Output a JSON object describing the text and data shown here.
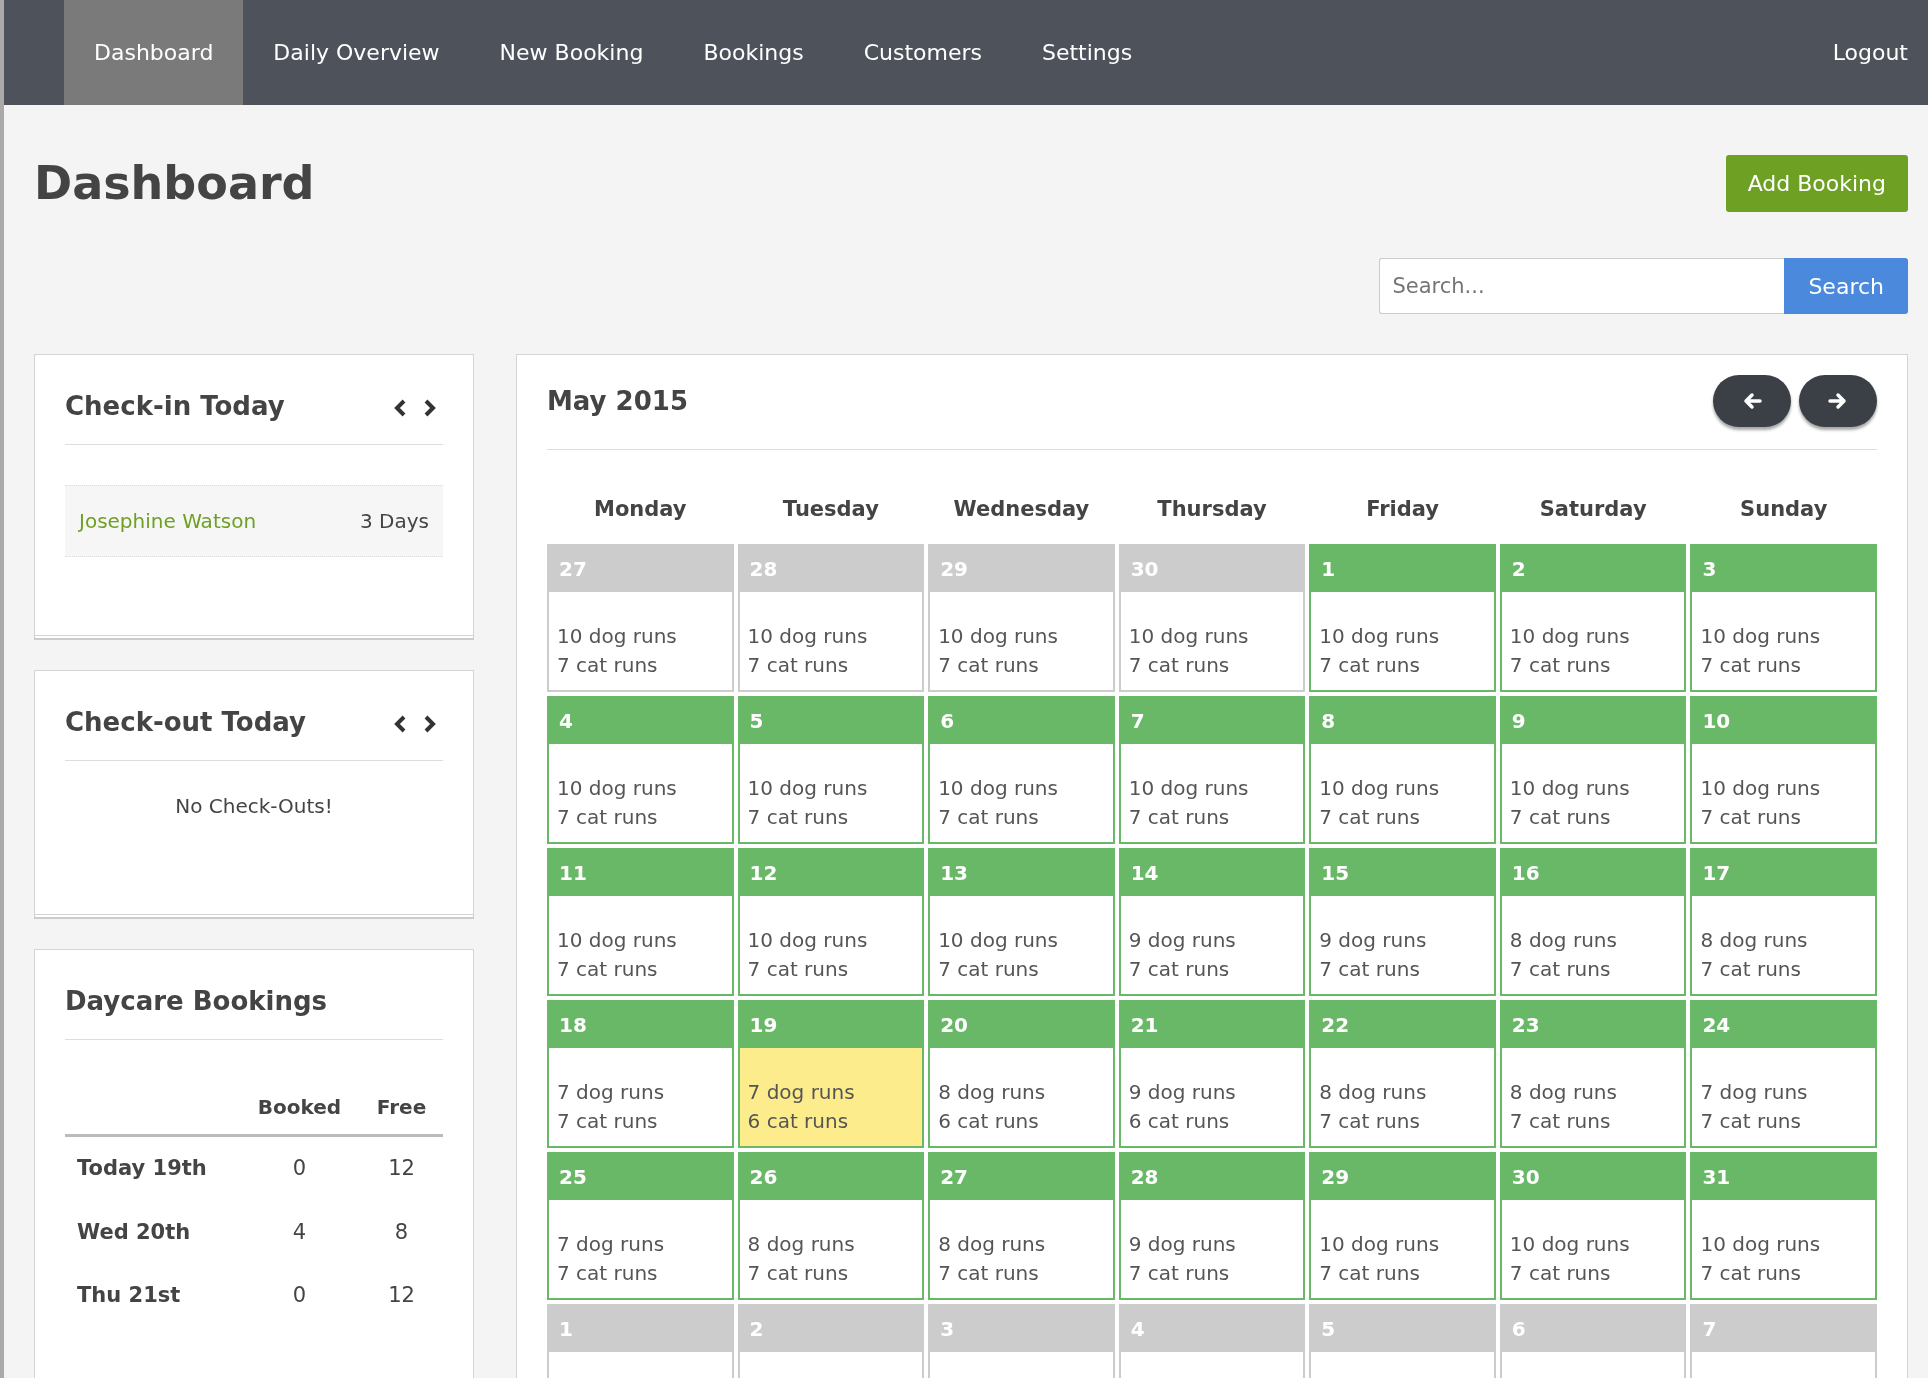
{
  "nav": {
    "items": [
      {
        "label": "Dashboard",
        "selected": true
      },
      {
        "label": "Daily Overview",
        "selected": false
      },
      {
        "label": "New Booking",
        "selected": false
      },
      {
        "label": "Bookings",
        "selected": false
      },
      {
        "label": "Customers",
        "selected": false
      },
      {
        "label": "Settings",
        "selected": false
      }
    ],
    "logout": "Logout"
  },
  "page_title": "Dashboard",
  "add_booking": "Add Booking",
  "search": {
    "placeholder": "Search...",
    "button": "Search"
  },
  "checkin": {
    "title": "Check-in Today",
    "rows": [
      {
        "name": "Josephine Watson",
        "duration": "3 Days"
      }
    ]
  },
  "checkout": {
    "title": "Check-out Today",
    "empty": "No Check-Outs!"
  },
  "daycare": {
    "title": "Daycare Bookings",
    "columns": [
      "Booked",
      "Free"
    ],
    "rows": [
      {
        "day": "Today 19th",
        "booked": "0",
        "free": "12"
      },
      {
        "day": "Wed 20th",
        "booked": "4",
        "free": "8"
      },
      {
        "day": "Thu 21st",
        "booked": "0",
        "free": "12"
      }
    ]
  },
  "calendar": {
    "title": "May 2015",
    "weekdays": [
      "Monday",
      "Tuesday",
      "Wednesday",
      "Thursday",
      "Friday",
      "Saturday",
      "Sunday"
    ],
    "weeks": [
      [
        {
          "day": "27",
          "in_month": false,
          "selected": false,
          "dog": "10 dog runs",
          "cat": "7 cat runs"
        },
        {
          "day": "28",
          "in_month": false,
          "selected": false,
          "dog": "10 dog runs",
          "cat": "7 cat runs"
        },
        {
          "day": "29",
          "in_month": false,
          "selected": false,
          "dog": "10 dog runs",
          "cat": "7 cat runs"
        },
        {
          "day": "30",
          "in_month": false,
          "selected": false,
          "dog": "10 dog runs",
          "cat": "7 cat runs"
        },
        {
          "day": "1",
          "in_month": true,
          "selected": false,
          "dog": "10 dog runs",
          "cat": "7 cat runs"
        },
        {
          "day": "2",
          "in_month": true,
          "selected": false,
          "dog": "10 dog runs",
          "cat": "7 cat runs"
        },
        {
          "day": "3",
          "in_month": true,
          "selected": false,
          "dog": "10 dog runs",
          "cat": "7 cat runs"
        }
      ],
      [
        {
          "day": "4",
          "in_month": true,
          "selected": false,
          "dog": "10 dog runs",
          "cat": "7 cat runs"
        },
        {
          "day": "5",
          "in_month": true,
          "selected": false,
          "dog": "10 dog runs",
          "cat": "7 cat runs"
        },
        {
          "day": "6",
          "in_month": true,
          "selected": false,
          "dog": "10 dog runs",
          "cat": "7 cat runs"
        },
        {
          "day": "7",
          "in_month": true,
          "selected": false,
          "dog": "10 dog runs",
          "cat": "7 cat runs"
        },
        {
          "day": "8",
          "in_month": true,
          "selected": false,
          "dog": "10 dog runs",
          "cat": "7 cat runs"
        },
        {
          "day": "9",
          "in_month": true,
          "selected": false,
          "dog": "10 dog runs",
          "cat": "7 cat runs"
        },
        {
          "day": "10",
          "in_month": true,
          "selected": false,
          "dog": "10 dog runs",
          "cat": "7 cat runs"
        }
      ],
      [
        {
          "day": "11",
          "in_month": true,
          "selected": false,
          "dog": "10 dog runs",
          "cat": "7 cat runs"
        },
        {
          "day": "12",
          "in_month": true,
          "selected": false,
          "dog": "10 dog runs",
          "cat": "7 cat runs"
        },
        {
          "day": "13",
          "in_month": true,
          "selected": false,
          "dog": "10 dog runs",
          "cat": "7 cat runs"
        },
        {
          "day": "14",
          "in_month": true,
          "selected": false,
          "dog": "9 dog runs",
          "cat": "7 cat runs"
        },
        {
          "day": "15",
          "in_month": true,
          "selected": false,
          "dog": "9 dog runs",
          "cat": "7 cat runs"
        },
        {
          "day": "16",
          "in_month": true,
          "selected": false,
          "dog": "8 dog runs",
          "cat": "7 cat runs"
        },
        {
          "day": "17",
          "in_month": true,
          "selected": false,
          "dog": "8 dog runs",
          "cat": "7 cat runs"
        }
      ],
      [
        {
          "day": "18",
          "in_month": true,
          "selected": false,
          "dog": "7 dog runs",
          "cat": "7 cat runs"
        },
        {
          "day": "19",
          "in_month": true,
          "selected": true,
          "dog": "7 dog runs",
          "cat": "6 cat runs"
        },
        {
          "day": "20",
          "in_month": true,
          "selected": false,
          "dog": "8 dog runs",
          "cat": "6 cat runs"
        },
        {
          "day": "21",
          "in_month": true,
          "selected": false,
          "dog": "9 dog runs",
          "cat": "6 cat runs"
        },
        {
          "day": "22",
          "in_month": true,
          "selected": false,
          "dog": "8 dog runs",
          "cat": "7 cat runs"
        },
        {
          "day": "23",
          "in_month": true,
          "selected": false,
          "dog": "8 dog runs",
          "cat": "7 cat runs"
        },
        {
          "day": "24",
          "in_month": true,
          "selected": false,
          "dog": "7 dog runs",
          "cat": "7 cat runs"
        }
      ],
      [
        {
          "day": "25",
          "in_month": true,
          "selected": false,
          "dog": "7 dog runs",
          "cat": "7 cat runs"
        },
        {
          "day": "26",
          "in_month": true,
          "selected": false,
          "dog": "8 dog runs",
          "cat": "7 cat runs"
        },
        {
          "day": "27",
          "in_month": true,
          "selected": false,
          "dog": "8 dog runs",
          "cat": "7 cat runs"
        },
        {
          "day": "28",
          "in_month": true,
          "selected": false,
          "dog": "9 dog runs",
          "cat": "7 cat runs"
        },
        {
          "day": "29",
          "in_month": true,
          "selected": false,
          "dog": "10 dog runs",
          "cat": "7 cat runs"
        },
        {
          "day": "30",
          "in_month": true,
          "selected": false,
          "dog": "10 dog runs",
          "cat": "7 cat runs"
        },
        {
          "day": "31",
          "in_month": true,
          "selected": false,
          "dog": "10 dog runs",
          "cat": "7 cat runs"
        }
      ],
      [
        {
          "day": "1",
          "in_month": false,
          "selected": false
        },
        {
          "day": "2",
          "in_month": false,
          "selected": false
        },
        {
          "day": "3",
          "in_month": false,
          "selected": false
        },
        {
          "day": "4",
          "in_month": false,
          "selected": false
        },
        {
          "day": "5",
          "in_month": false,
          "selected": false
        },
        {
          "day": "6",
          "in_month": false,
          "selected": false
        },
        {
          "day": "7",
          "in_month": false,
          "selected": false
        }
      ]
    ]
  }
}
